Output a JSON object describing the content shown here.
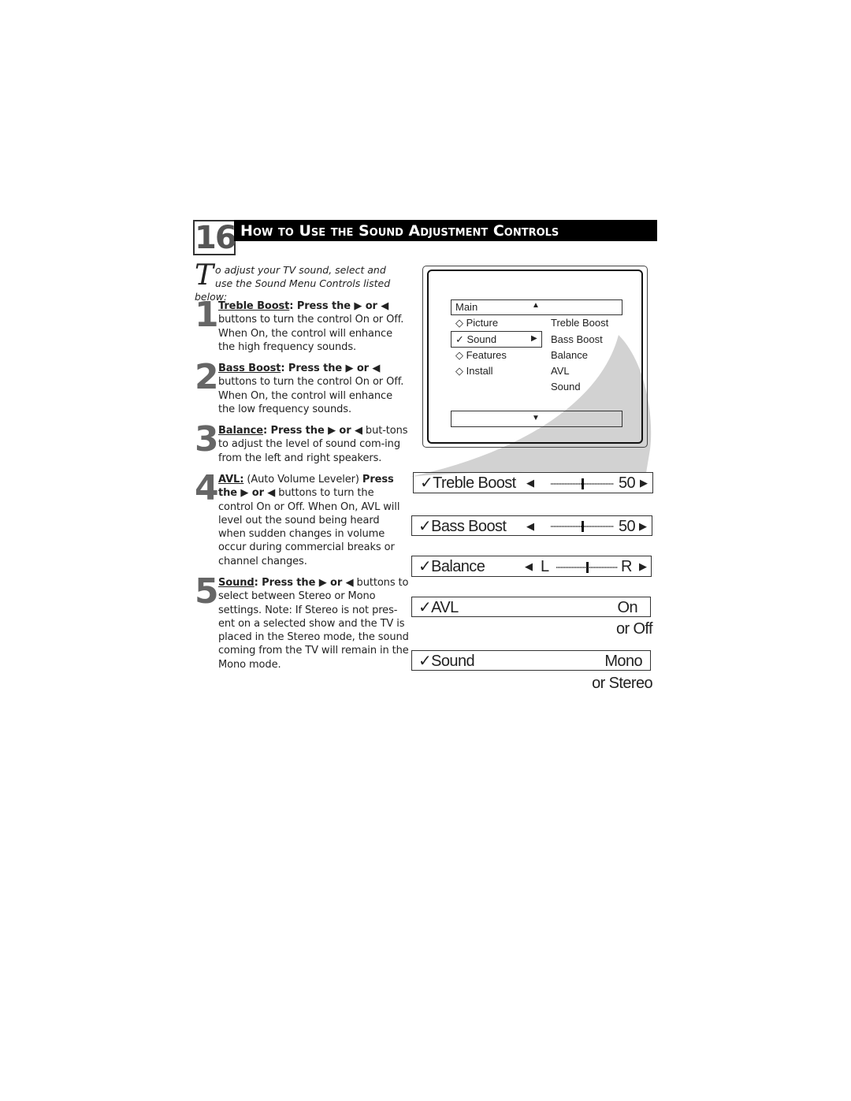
{
  "header": {
    "page_number": "16",
    "title": "How to Use the Sound Adjustment Controls"
  },
  "intro": {
    "drop_cap": "T",
    "text": "o adjust your TV sound, select and use the Sound Menu Controls listed below:"
  },
  "steps": [
    {
      "number": "1",
      "term": "Treble Boost",
      "lead": ":  Press the ▶ or ◀",
      "body": " buttons to turn the control On or Off. When On, the control will enhance the high frequency sounds."
    },
    {
      "number": "2",
      "term": "Bass Boost",
      "lead": ":  Press the ▶ or ◀",
      "body": " buttons to turn the control On or Off. When On, the control will enhance the low frequency sounds."
    },
    {
      "number": "3",
      "term": "Balance",
      "lead": ":  Press the ▶ or ◀",
      "body": " but-tons to adjust the level of sound com-ing from the left and right speakers."
    },
    {
      "number": "4",
      "term": "AVL:",
      "pre": "  (Auto Volume Leveler) ",
      "lead": "Press the ▶ or ◀",
      "body": " buttons to turn the control On or Off. When On, AVL will level out the sound being heard when sudden changes in volume occur during commercial breaks or channel changes."
    },
    {
      "number": "5",
      "term": "Sound",
      "lead": ": Press the ▶ or ◀",
      "body": " buttons to select between Stereo or Mono settings. Note: If Stereo is not pres-ent on a selected show and the TV is placed in the Stereo mode, the sound coming from the TV will remain in the Mono mode."
    }
  ],
  "menu": {
    "title": "Main",
    "left_items": [
      "◇ Picture",
      "✓ Sound",
      "◇ Features",
      "◇ Install"
    ],
    "right_items": [
      "Treble Boost",
      "Bass Boost",
      "Balance",
      "AVL",
      "Sound"
    ],
    "icons": {
      "up": "triangle-up",
      "down": "triangle-down",
      "right": "triangle-right"
    }
  },
  "controls": {
    "treble": {
      "label": "✓Treble Boost",
      "value": "50",
      "level_percent": 50
    },
    "bass": {
      "label": "✓Bass Boost",
      "value": "50",
      "level_percent": 50
    },
    "balance": {
      "label": "✓Balance",
      "left": "L",
      "right": "R",
      "level_percent": 50
    },
    "avl": {
      "label": "✓AVL",
      "value": "On",
      "alt": "or Off"
    },
    "sound": {
      "label": "✓Sound",
      "value": "Mono",
      "alt": "or Stereo"
    }
  }
}
